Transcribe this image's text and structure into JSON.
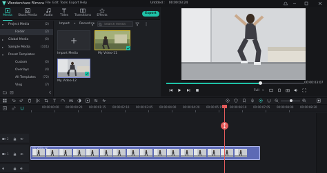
{
  "app": {
    "title": "Wondershare Filmora",
    "menu": [
      "File",
      "Edit",
      "Tools",
      "Export",
      "Help"
    ],
    "doc_title": "Untitled :",
    "doc_timecode": "00:00:03:24"
  },
  "toolbar": {
    "tabs": [
      {
        "label": "Media",
        "icon": "media-icon",
        "active": true
      },
      {
        "label": "Stock Media",
        "icon": "stock-media-icon",
        "active": false
      },
      {
        "label": "Audio",
        "icon": "audio-icon",
        "active": false
      },
      {
        "label": "Titles",
        "icon": "titles-icon",
        "active": false
      },
      {
        "label": "Transitions",
        "icon": "transitions-icon",
        "active": false
      },
      {
        "label": "Effects",
        "icon": "effects-icon",
        "active": false
      }
    ],
    "export_label": "Export"
  },
  "sidebar": {
    "items": [
      {
        "label": "Project Media",
        "count": "(2)",
        "expanded": true,
        "indent": 0
      },
      {
        "label": "Folder",
        "count": "(2)",
        "expanded": null,
        "indent": 1
      },
      {
        "label": "Global Media",
        "count": "(0)",
        "expanded": false,
        "indent": 0
      },
      {
        "label": "Sample Media",
        "count": "(101)",
        "expanded": false,
        "indent": 0
      },
      {
        "label": "Preset Templates",
        "count": "",
        "expanded": true,
        "indent": 0
      },
      {
        "label": "Custom",
        "count": "(0)",
        "expanded": null,
        "indent": 1
      },
      {
        "label": "Overlays",
        "count": "(4)",
        "expanded": null,
        "indent": 1
      },
      {
        "label": "All Templates",
        "count": "(72)",
        "expanded": null,
        "indent": 1
      },
      {
        "label": "Vlog",
        "count": "(7)",
        "expanded": null,
        "indent": 1
      }
    ]
  },
  "media": {
    "import_label": "Import",
    "record_label": "Record",
    "search_placeholder": "Search media",
    "tiles": [
      {
        "label": "Import Media",
        "type": "import"
      },
      {
        "label": "My Video-11",
        "type": "video"
      },
      {
        "label": "My Video-12",
        "type": "video"
      }
    ]
  },
  "player": {
    "progress": 0.68,
    "timecode": "00:00:03:07",
    "quality": "Full"
  },
  "timeline": {
    "ruler_labels": [
      "00:00:00:00",
      "00:00:00:20",
      "00:00:01:15",
      "00:00:02:10",
      "00:00:03:05",
      "00:00:04:00",
      "00:00:04:20",
      "00:00:05:15",
      "00:00:06:10",
      "00:00:07:05",
      "00:00:08:00",
      "00:00:08:20"
    ],
    "playhead_label": "00:00:03:05",
    "clip_label": "My Video-12",
    "tracks": [
      "2",
      "1"
    ]
  },
  "colors": {
    "accent": "#1ec2a8",
    "playhead": "#e35b5b",
    "clip": "#5d6ab5"
  }
}
